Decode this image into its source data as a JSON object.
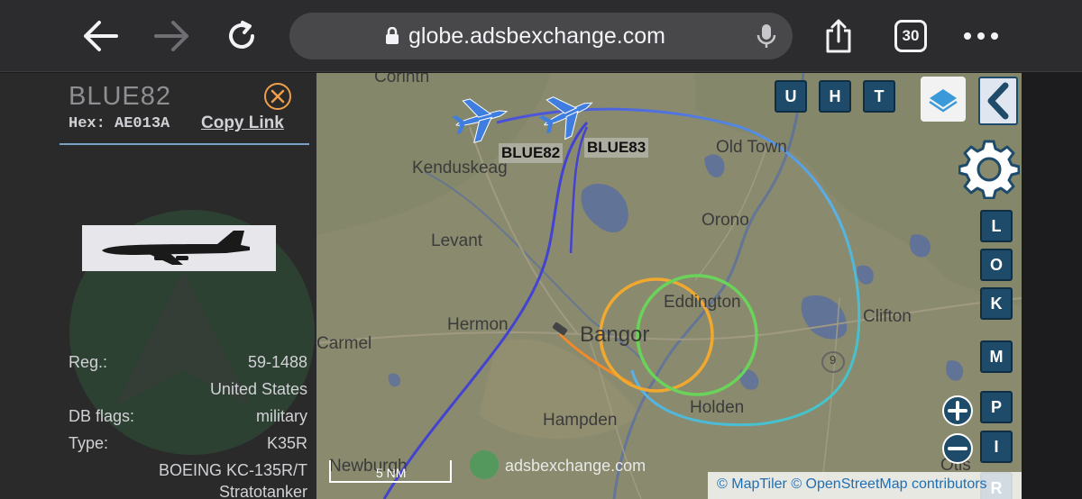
{
  "browser": {
    "url": "globe.adsbexchange.com",
    "tab_count": "30"
  },
  "sidebar": {
    "callsign": "BLUE82",
    "hex_label": "Hex: AE013A",
    "copy_link": "Copy Link",
    "reg_label": "Reg.:",
    "reg_value": "59-1488",
    "country": "United States",
    "db_flags_label": "DB flags:",
    "db_flags_value": "military",
    "type_label": "Type:",
    "type_value": "K35R",
    "description_line1": "BOEING KC-135R/T",
    "description_line2": "Stratotanker"
  },
  "map": {
    "places": {
      "corinth": "Corinth",
      "kenduskeag": "Kenduskeag",
      "old_town": "Old Town",
      "orono": "Orono",
      "levant": "Levant",
      "hermon": "Hermon",
      "bangor": "Bangor",
      "eddington": "Eddington",
      "clifton": "Clifton",
      "carmel": "Carmel",
      "hampden": "Hampden",
      "holden": "Holden",
      "newburgh": "Newburgh",
      "otis": "Otis"
    },
    "route_marker": "9",
    "aircraft_labels": {
      "blue82": "BLUE82",
      "blue83": "BLUE83"
    },
    "buttons": {
      "u": "U",
      "h": "H",
      "t": "T",
      "l": "L",
      "o": "O",
      "k": "K",
      "m": "M",
      "p": "P",
      "i": "I",
      "r": "R"
    },
    "scale_label": "5 NM",
    "watermark": "adsbexchange.com",
    "attribution": "© MapTiler © OpenStreetMap contributors"
  }
}
